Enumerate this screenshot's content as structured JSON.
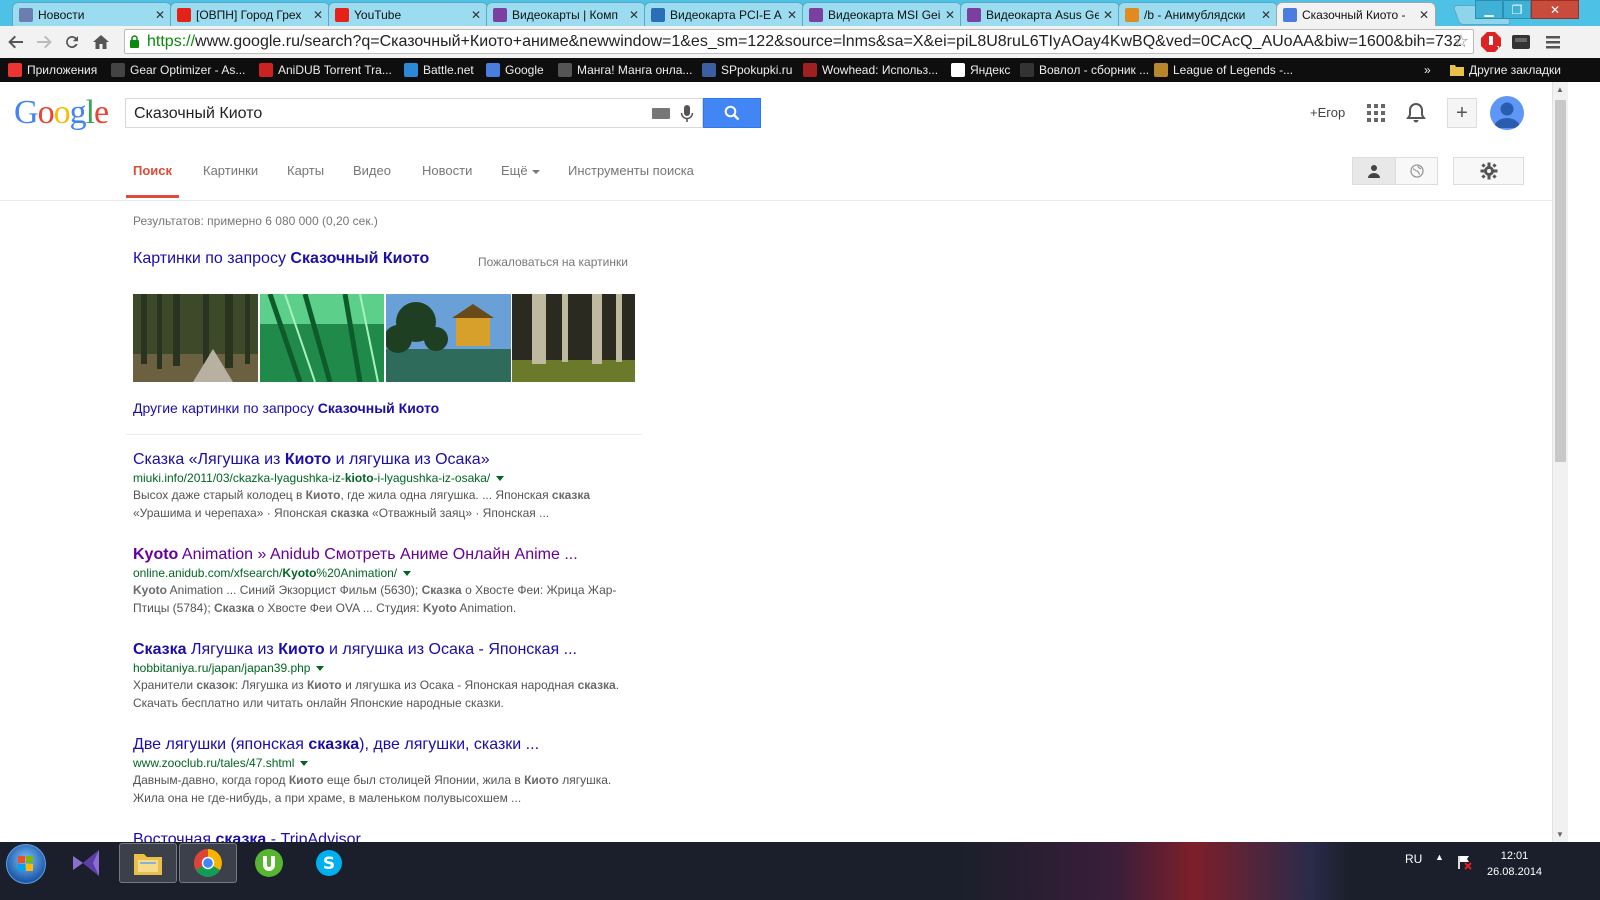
{
  "browser": {
    "tabs": [
      {
        "title": "Новости",
        "favicon": "pause-icon",
        "color": "#6a7fb0"
      },
      {
        "title": "[ОВПН] Город Грех",
        "favicon": "youtube-icon",
        "color": "#e62117"
      },
      {
        "title": "YouTube",
        "favicon": "youtube-icon",
        "color": "#e62117"
      },
      {
        "title": "Видеокарты | Комп",
        "favicon": "price-icon",
        "color": "#7b3fa0"
      },
      {
        "title": "Видеокарта PCI-E A",
        "favicon": "dns-icon",
        "color": "#2a6fb5"
      },
      {
        "title": "Видеокарта MSI Gei",
        "favicon": "price-icon",
        "color": "#7b3fa0"
      },
      {
        "title": "Видеокарта Asus Ge",
        "favicon": "price-icon",
        "color": "#7b3fa0"
      },
      {
        "title": "/b - Анимублядски",
        "favicon": "bolt-icon",
        "color": "#e08a20"
      },
      {
        "title": "Сказочный Киото -",
        "favicon": "google-icon",
        "color": "#4a7de0"
      }
    ],
    "url_scheme": "https://",
    "url_rest": "www.google.ru/search?q=Сказочный+Киото+аниме&newwindow=1&es_sm=122&source=lnms&sa=X&ei=piL8U8ruL6TIyAOay4KwBQ&ved=0CAcQ_AUoAA&biw=1600&bih=732",
    "bookmarks": [
      {
        "label": "Приложения",
        "icon": "apps-grid-icon",
        "color": "#e33"
      },
      {
        "label": "Gear Optimizer - As...",
        "icon": "gear-optimizer-icon",
        "color": "#444"
      },
      {
        "label": "AniDUB Torrent Tra...",
        "icon": "anidub-icon",
        "color": "#c22"
      },
      {
        "label": "Battle.net",
        "icon": "battlenet-icon",
        "color": "#2a8ad8"
      },
      {
        "label": "Google",
        "icon": "google-icon",
        "color": "#4a7de0"
      },
      {
        "label": "Манга! Манга онла...",
        "icon": "manga-icon",
        "color": "#555"
      },
      {
        "label": "SPpokupki.ru",
        "icon": "sp-icon",
        "color": "#3b5fa0"
      },
      {
        "label": "Wowhead: Использ...",
        "icon": "wowhead-icon",
        "color": "#a02020"
      },
      {
        "label": "Яндекс",
        "icon": "yandex-icon",
        "color": "#fff"
      },
      {
        "label": "Вовлол - сборник ...",
        "icon": "lol-icon",
        "color": "#333"
      },
      {
        "label": "League of Legends -...",
        "icon": "league-icon",
        "color": "#b8862b"
      }
    ],
    "other_bookmarks": "Другие закладки",
    "more_chevron": "»"
  },
  "google": {
    "logo": "Google",
    "query": "Сказочный Киото",
    "user_link": "+Егор",
    "tabs": [
      {
        "label": "Поиск",
        "active": true
      },
      {
        "label": "Картинки"
      },
      {
        "label": "Карты"
      },
      {
        "label": "Видео"
      },
      {
        "label": "Новости"
      },
      {
        "label": "Ещё",
        "dropdown": true
      },
      {
        "label": "Инструменты поиска"
      }
    ],
    "stats": "Результатов: примерно 6 080 000 (0,20 сек.)",
    "images_title_prefix": "Картинки по запросу ",
    "images_title_bold": "Сказочный Киото",
    "images_report": "Пожаловаться на картинки",
    "more_images_prefix": "Другие картинки по запросу ",
    "more_images_bold": "Сказочный Киото",
    "results": [
      {
        "title_parts": [
          {
            "t": "Сказка «Лягушка из "
          },
          {
            "t": "Киото",
            "b": true
          },
          {
            "t": " и лягушка из Осака»"
          }
        ],
        "url_parts": [
          {
            "t": "miuki.info/2011/03/ckazka-lyagushka-iz-"
          },
          {
            "t": "kioto",
            "b": true
          },
          {
            "t": "-i-lyagushka-iz-osaka/"
          }
        ],
        "snippet_parts": [
          {
            "t": "Высох даже старый колодец в "
          },
          {
            "t": "Киото",
            "b": true
          },
          {
            "t": ", где жила одна лягушка. ... Японская "
          },
          {
            "t": "сказка",
            "b": true
          },
          {
            "t": " «Урашима и черепаха» · Японская "
          },
          {
            "t": "сказка",
            "b": true
          },
          {
            "t": " «Отважный заяц» · Японская ..."
          }
        ],
        "visited": false
      },
      {
        "title_parts": [
          {
            "t": "Kyoto",
            "b": true
          },
          {
            "t": " Animation » Anidub Смотреть Аниме Онлайн Anime ..."
          }
        ],
        "url_parts": [
          {
            "t": "online.anidub.com/xfsearch/"
          },
          {
            "t": "Kyoto",
            "b": true
          },
          {
            "t": "%20Animation/"
          }
        ],
        "snippet_parts": [
          {
            "t": "Kyoto",
            "b": true
          },
          {
            "t": " Animation ... Синий Экзорцист Фильм (5630); "
          },
          {
            "t": "Сказка",
            "b": true
          },
          {
            "t": " о Хвосте Феи: Жрица Жар-Птицы (5784); "
          },
          {
            "t": "Сказка",
            "b": true
          },
          {
            "t": " о Хвосте Феи OVA ... Студия: "
          },
          {
            "t": "Kyoto",
            "b": true
          },
          {
            "t": " Animation."
          }
        ],
        "visited": true
      },
      {
        "title_parts": [
          {
            "t": "Сказка",
            "b": true
          },
          {
            "t": " Лягушка из "
          },
          {
            "t": "Киото",
            "b": true
          },
          {
            "t": " и лягушка из Осака - Японская ..."
          }
        ],
        "url_parts": [
          {
            "t": "hobbitaniya.ru/japan/japan39.php"
          }
        ],
        "snippet_parts": [
          {
            "t": "Хранители "
          },
          {
            "t": "сказок",
            "b": true
          },
          {
            "t": ": Лягушка из "
          },
          {
            "t": "Киото",
            "b": true
          },
          {
            "t": " и лягушка из Осака - Японская народная "
          },
          {
            "t": "сказка",
            "b": true
          },
          {
            "t": ". Скачать бесплатно или читать онлайн Японские народные сказки."
          }
        ],
        "visited": false
      },
      {
        "title_parts": [
          {
            "t": "Две лягушки (японская "
          },
          {
            "t": "сказка",
            "b": true
          },
          {
            "t": "), две лягушки, сказки ..."
          }
        ],
        "url_parts": [
          {
            "t": "www.zooclub.ru/tales/47.shtml"
          }
        ],
        "snippet_parts": [
          {
            "t": "Давным-давно, когда город "
          },
          {
            "t": "Киото",
            "b": true
          },
          {
            "t": " еще был столицей Японии, жила в "
          },
          {
            "t": "Киото",
            "b": true
          },
          {
            "t": " лягушка. Жила она не где-нибудь, а при храме, в маленьком полувысохшем ..."
          }
        ],
        "visited": false
      },
      {
        "title_parts": [
          {
            "t": "Восточная "
          },
          {
            "t": "сказка",
            "b": true
          },
          {
            "t": " - TripAdvisor"
          }
        ],
        "url_parts": [],
        "snippet_parts": [],
        "visited": false
      }
    ]
  },
  "taskbar": {
    "lang": "RU",
    "time": "12:01",
    "date": "26.08.2014",
    "apps": [
      "visual-studio-icon",
      "file-explorer-icon",
      "chrome-icon",
      "utorrent-icon",
      "skype-icon"
    ]
  },
  "colors": {
    "link": "#1a0dab",
    "visited": "#660099",
    "url_green": "#006621",
    "google_blue": "#4285f4",
    "active_tab_red": "#dd4b39"
  }
}
